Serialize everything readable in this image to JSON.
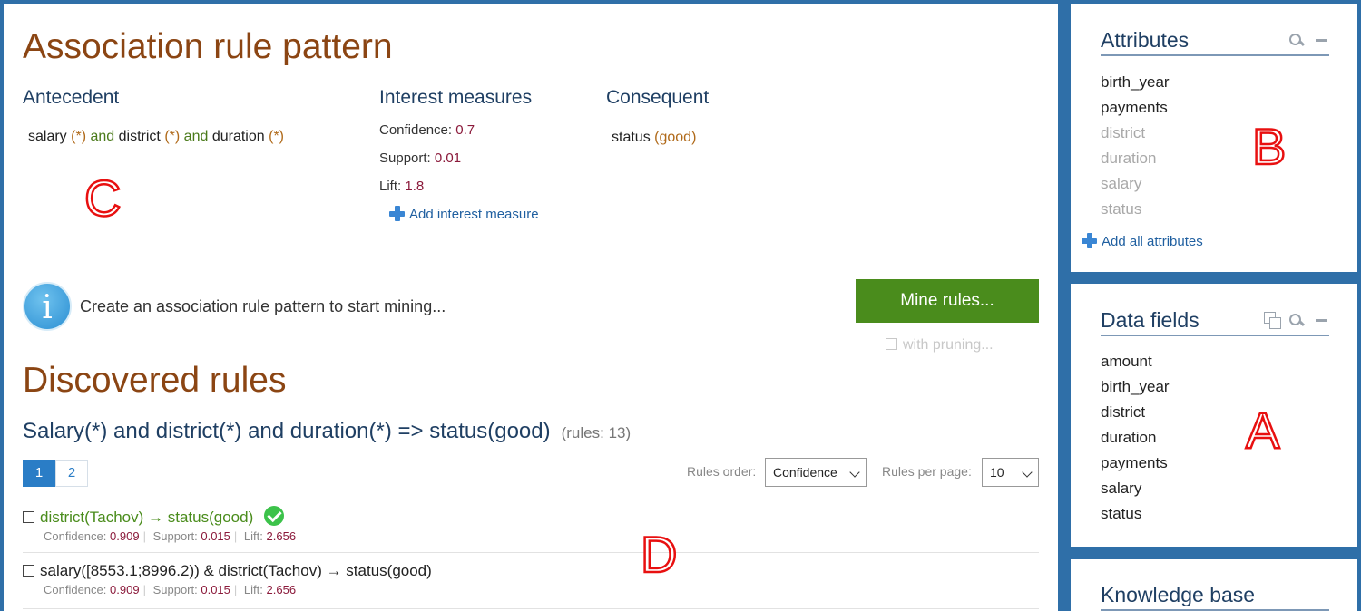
{
  "pattern": {
    "title": "Association rule pattern",
    "antecedent_header": "Antecedent",
    "interest_header": "Interest measures",
    "consequent_header": "Consequent",
    "antecedent": {
      "a1": "salary",
      "p1": "(*)",
      "and1": "and",
      "a2": "district",
      "p2": "(*)",
      "and2": "and",
      "a3": "duration",
      "p3": "(*)"
    },
    "measures": [
      {
        "label": "Confidence:",
        "value": "0.7"
      },
      {
        "label": "Support:",
        "value": "0.01"
      },
      {
        "label": "Lift:",
        "value": "1.8"
      }
    ],
    "add_measure": "Add interest measure",
    "consequent": {
      "attr": "status",
      "val": "(good)"
    }
  },
  "info": {
    "icon": "i",
    "text": "Create an association rule pattern to start mining..."
  },
  "mine": {
    "button": "Mine rules...",
    "pruning": "with pruning..."
  },
  "discovered": {
    "title": "Discovered rules",
    "task": "Salary(*) and district(*) and duration(*) => status(good)",
    "count": "(rules: 13)",
    "pages": [
      "1",
      "2"
    ],
    "order_label": "Rules order:",
    "order_value": "Confidence",
    "per_page_label": "Rules per page:",
    "per_page_value": "10",
    "rules": [
      {
        "text": "district(Tachov) → status(good)",
        "conf_label": "Confidence:",
        "conf": "0.909",
        "supp_label": "Support:",
        "supp": "0.015",
        "lift_label": "Lift:",
        "lift": "2.656",
        "accepted": true
      },
      {
        "text": "salary([8553.1;8996.2)) & district(Tachov) → status(good)",
        "conf_label": "Confidence:",
        "conf": "0.909",
        "supp_label": "Support:",
        "supp": "0.015",
        "lift_label": "Lift:",
        "lift": "2.656",
        "accepted": false
      }
    ]
  },
  "attributes": {
    "title": "Attributes",
    "items": [
      {
        "label": "birth_year",
        "state": "active"
      },
      {
        "label": "payments",
        "state": "active"
      },
      {
        "label": "district",
        "state": "used"
      },
      {
        "label": "duration",
        "state": "used"
      },
      {
        "label": "salary",
        "state": "used"
      },
      {
        "label": "status",
        "state": "used"
      }
    ],
    "add_all": "Add all attributes"
  },
  "data_fields": {
    "title": "Data fields",
    "items": [
      "amount",
      "birth_year",
      "district",
      "duration",
      "payments",
      "salary",
      "status"
    ]
  },
  "knowledge_base": {
    "title": "Knowledge base"
  },
  "annotations": {
    "a": "A",
    "b": "B",
    "c": "C",
    "d": "D"
  },
  "colors": {
    "brand_title": "#8b4513",
    "accent_blue": "#2a7dc6",
    "mine_green": "#4a8c1c",
    "value_red": "#8b1a3b",
    "annotation_red": "#e81010",
    "frame_blue": "#2f6fa8"
  }
}
